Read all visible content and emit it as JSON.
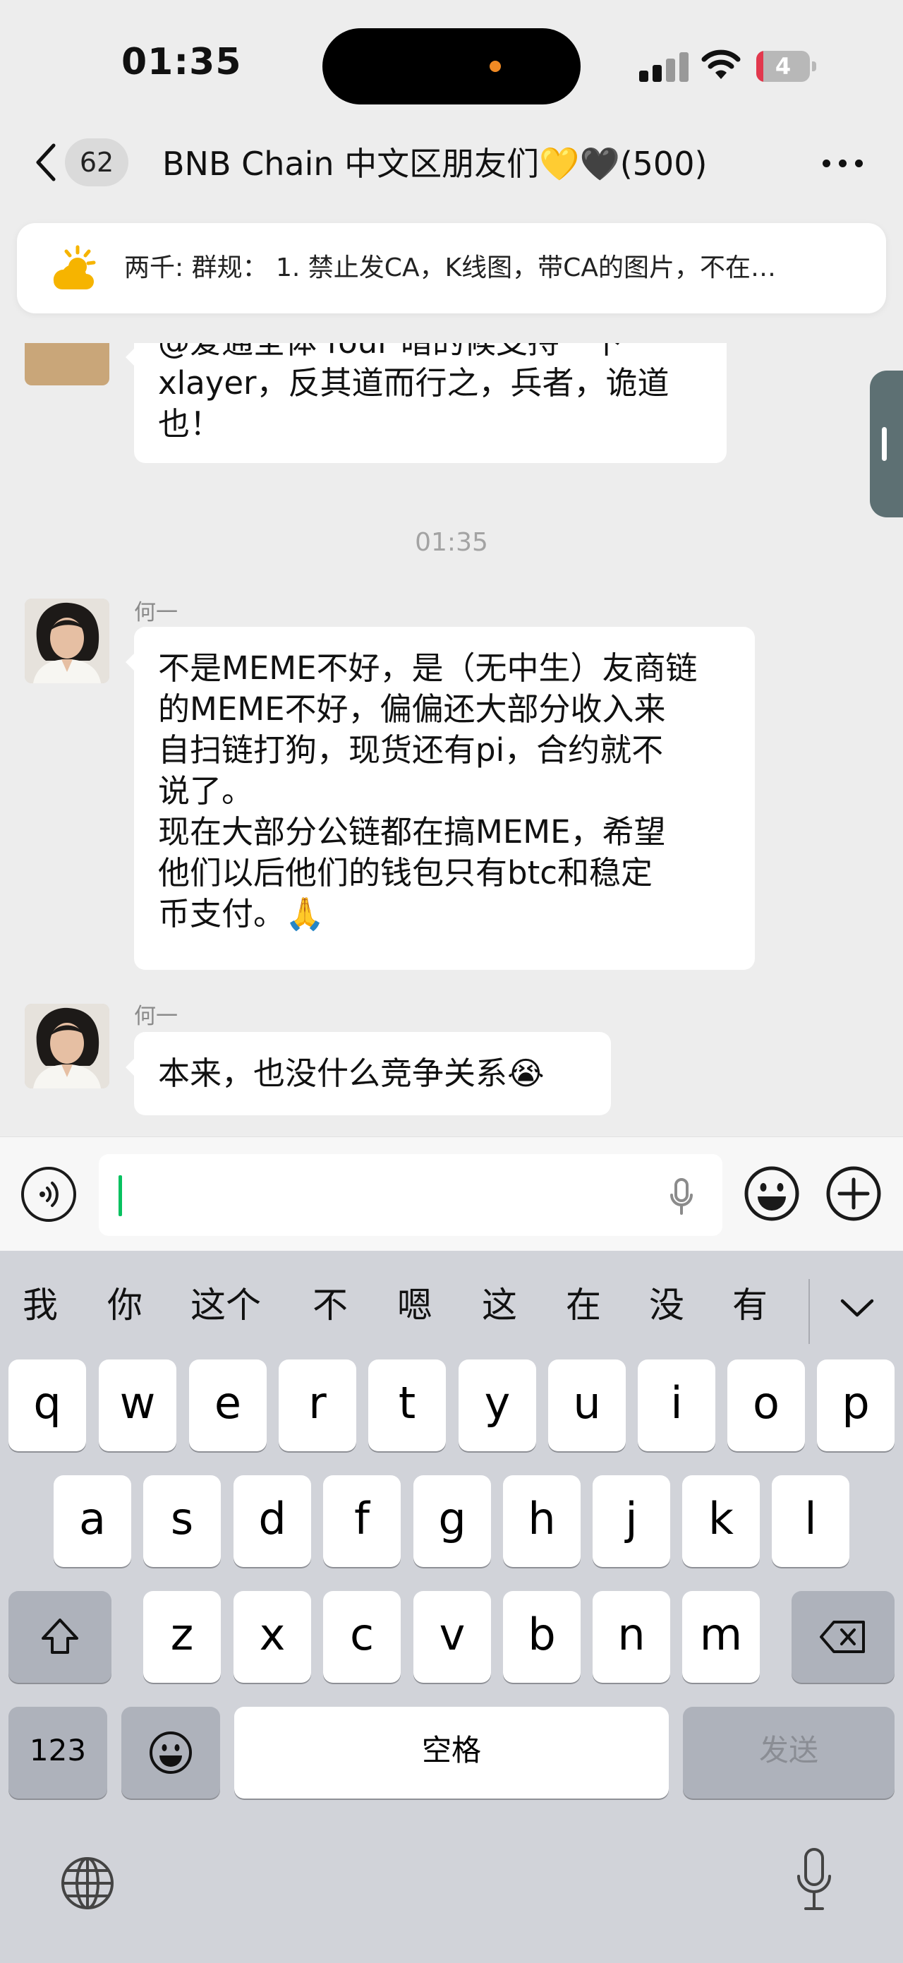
{
  "status_bar": {
    "time": "01:35",
    "battery": "4"
  },
  "nav": {
    "unread_count": "62",
    "title": "BNB Chain 中文区朋友们💛🖤(500)"
  },
  "notice": {
    "text": "两千: 群规： 1. 禁止发CA，K线图，带CA的图片，不在…"
  },
  "messages": {
    "partial_lines": [
      "@爱通全体 four 暗的候支持一下",
      "xlayer，反其道而行之，兵者，诡道",
      "也！"
    ],
    "timestamp": "01:35",
    "m1": {
      "sender": "何一",
      "lines": [
        "不是MEME不好，是（无中生）友商链",
        "的MEME不好，偏偏还大部分收入来",
        "自扫链打狗，现货还有pi，合约就不",
        "说了。",
        "现在大部分公链都在搞MEME，希望",
        "他们以后他们的钱包只有btc和稳定",
        "币支付。🙏"
      ]
    },
    "m2": {
      "sender": "何一",
      "text": "本来，也没什么竞争关系😭"
    }
  },
  "keyboard": {
    "candidates": [
      "我",
      "你",
      "这个",
      "不",
      "嗯",
      "这",
      "在",
      "没",
      "有"
    ],
    "row1": [
      "q",
      "w",
      "e",
      "r",
      "t",
      "y",
      "u",
      "i",
      "o",
      "p"
    ],
    "row2": [
      "a",
      "s",
      "d",
      "f",
      "g",
      "h",
      "j",
      "k",
      "l"
    ],
    "row3": [
      "z",
      "x",
      "c",
      "v",
      "b",
      "n",
      "m"
    ],
    "numbers_key": "123",
    "space_key": "空格",
    "send_key": "发送"
  },
  "icons": {
    "back": "chevron-left-icon",
    "more": "more-dots-icon",
    "notice": "sun-announcement-icon",
    "voice": "voice-mode-icon",
    "mic": "microphone-icon",
    "emoji": "emoji-icon",
    "plus": "plus-circle-icon",
    "shift": "shift-icon",
    "delete": "backspace-icon",
    "globe": "globe-icon",
    "dictation": "dictation-icon"
  },
  "colors": {
    "accent_green": "#07c160",
    "chat_background": "#ededed",
    "keyboard_background": "#d1d3d9",
    "battery_low": "#e2384d"
  }
}
